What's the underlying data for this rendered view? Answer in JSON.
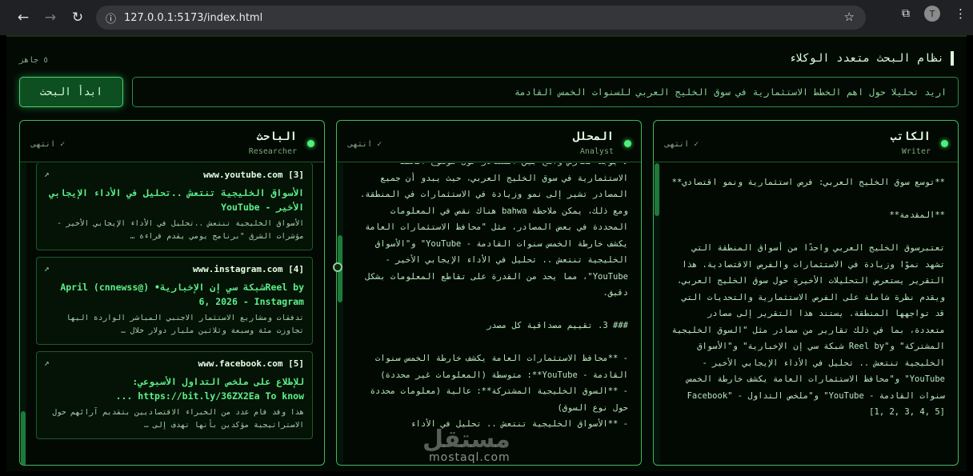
{
  "browser": {
    "url": "127.0.0.1:5173/index.html",
    "avatar_letter": "T"
  },
  "app": {
    "title": "نظام البحث متعدد الوكلاء",
    "status": "٥ جاهز",
    "start_button": "ابدأ البحث",
    "query": "اريد تحليلا حول اهم الخطط الاستثمارية في سوق الخليج العربي للسنوات الخمس القادمة"
  },
  "panels": {
    "writer": {
      "name": "الكاتب",
      "subtitle": "Writer",
      "status": "✓ انتهى",
      "content": "**توسع سوق الخليج العربي: فرص استثمارية ونمو اقتصادي**\n\n**المقدمة**\n\nتعتبرسوق الخليج العربي واحدًا من أسواق المنطقة التي تشهد نموًا وزيادة في الاستثمارات والفرص الاقتصادية. هذا التقرير يستعرض التحليلات الأخيرة حول سوق الخليج العربي، ويقدم نظرة شاملة على الفرص الاستثمارية والتحديات التي قد تواجهها المنطقة. يستند هذا التقرير إلى مصادر متعددة، بما في ذلك تقارير من مصادر مثل \"السوق الخليجية المشتركة\" و\"Reel by شبكة سي إن الإخبارية\" و\"الأسواق الخليجية تنتعش .. تحليل في الأداء الإيجابي الأخير - YouTube\" و\"محافظ الاستثمارات العامة يكشف خارطة الخمس سنوات القادمة - YouTube\" و\"ملخص التداول - Facebook\" [1, 2, 3, 4, 5]"
    },
    "analyst": {
      "name": "المحلل",
      "subtitle": "Analyst",
      "status": "✓ انتهى",
      "content": "لا يوجد تعارض واضح بين المصادر حول موضوع الخطط الاستثمارية في سوق الخليج العربي، حيث يبدو أن جميع المصادر تشير إلى نمو وزيادة في الاستثمارات في المنطقة. ومع ذلك، يمكن ملاحظة bahwa هناك نقص في المعلومات المحددة في بعض المصادر، مثل \"محافظ الاستثمارات العامة يكشف خارطة الخمس سنوات القادمة - YouTube\" و\"الأسواق الخليجية تنتعش .. تحليل في الأداء الإيجابي الأخير - YouTube\"، مما يحد من القدرة على تقاطع المعلومات بشكل دقيق.\n\n### 3. تقييم مصداقية كل مصدر\n\n- **محافظ الاستثمارات العامة يكشف خارطة الخمس سنوات القادمة - YouTube**: متوسطة (المعلومات غير محددة)\n- **السوق الخليجية المشتركة**: عالية (معلومات محددة حول نوع السوق)\n- **الأسواق الخليجية تنتعش .. تحليل في الأداء"
    },
    "researcher": {
      "name": "الباحث",
      "subtitle": "Researcher",
      "status": "✓ انتهى",
      "sources": [
        {
          "source": "www.youtube.com [3]",
          "title": "الأسواق الخليجية تنتعش ..تحليل في الأداء الإيجابي الأخير - YouTube",
          "snippet": "الأسواق الخليجية تنتعش ..تحليل في الأداء الإيجابي الأخير - مؤشرات الشرق \"برنامج يومي يقدم قراءة …"
        },
        {
          "source": "www.instagram.com [4]",
          "title": "Reel byشبكة سي إن الإخبارية• (@cnnewss) April 6, 2026 - Instagram",
          "snippet": "تدفقات ومشاريع الاستثمار الاجنبي المباشر الواردة اليها تجاوزت مئة وسبعة وثلاثين مليار دولار خلال …"
        },
        {
          "source": "www.facebook.com [5]",
          "title": "للإطلاع على ملخص التداول الأسبوعي: https://bit.ly/36ZX2Ea To know ...",
          "snippet": "هذا وقد قام عدد من الخبراء الاقتصاديين بتقديم آرائهم حول الاستراتيجية مؤكدين بأنها تهدف إلى …"
        }
      ]
    }
  },
  "watermark": {
    "arabic": "مستقل",
    "latin": "mostaql.com"
  }
}
